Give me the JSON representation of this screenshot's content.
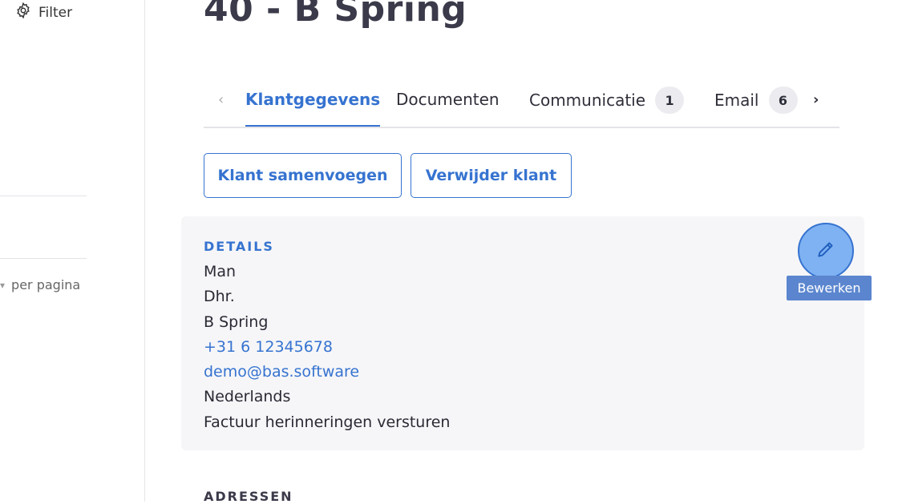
{
  "sidebar": {
    "filter_label": "Filter",
    "per_page_label": "per pagina"
  },
  "page": {
    "title": "40 - B Spring"
  },
  "tabs": {
    "items": [
      {
        "label": "Klantgegevens",
        "active": true
      },
      {
        "label": "Documenten"
      },
      {
        "label": "Communicatie",
        "badge": "1"
      },
      {
        "label": "Email",
        "badge": "6"
      }
    ]
  },
  "actions": {
    "merge_label": "Klant samenvoegen",
    "delete_label": "Verwijder klant"
  },
  "details": {
    "title": "DETAILS",
    "gender": "Man",
    "salutation": "Dhr.",
    "name": "B Spring",
    "phone": "+31 6 12345678",
    "email": "demo@bas.software",
    "language": "Nederlands",
    "reminder": "Factuur herinneringen versturen",
    "edit_tooltip": "Bewerken"
  },
  "addresses": {
    "title": "ADRESSEN"
  },
  "colors": {
    "accent": "#3673d0",
    "card_bg": "#f6f6f8",
    "tooltip_bg": "#5b86cf"
  }
}
